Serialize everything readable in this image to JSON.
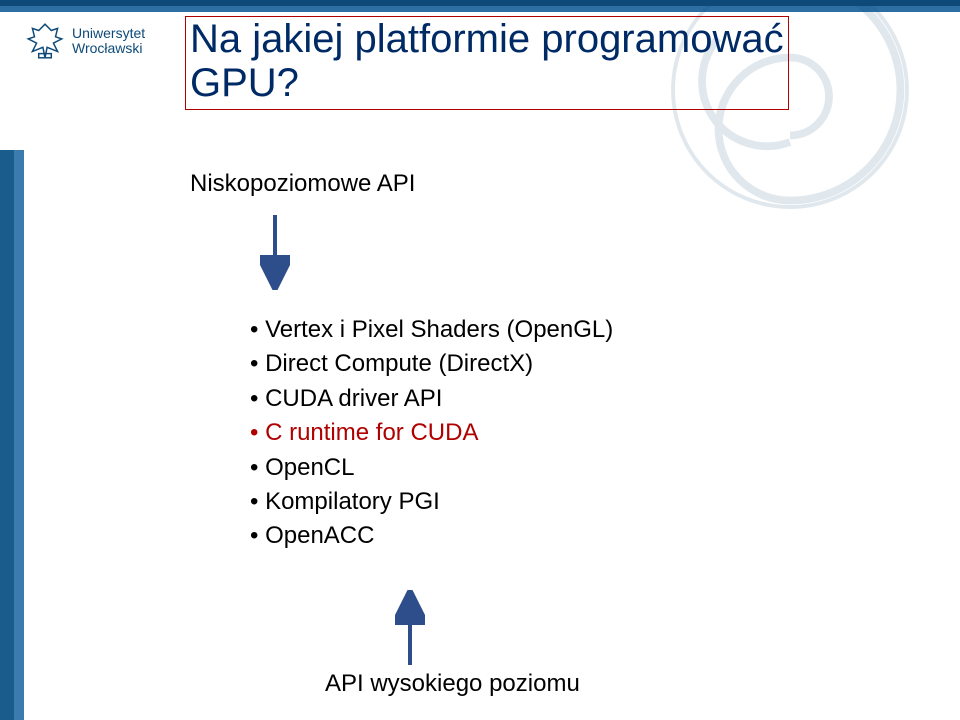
{
  "university": {
    "line1": "Uniwersytet",
    "line2": "Wrocławski"
  },
  "title": {
    "line1": "Na jakiej platformie programować",
    "line2": "GPU?"
  },
  "labels": {
    "top": "Niskopoziomowe API",
    "bottom": "API wysokiego poziomu"
  },
  "bullets": [
    {
      "text": "Vertex i Pixel Shaders (OpenGL)",
      "hl": false
    },
    {
      "text": "Direct Compute (DirectX)",
      "hl": false
    },
    {
      "text": "CUDA driver API",
      "hl": false
    },
    {
      "text": "C runtime for CUDA",
      "hl": true
    },
    {
      "text": "OpenCL",
      "hl": false
    },
    {
      "text": "Kompilatory PGI",
      "hl": false
    },
    {
      "text": "OpenACC",
      "hl": false
    }
  ],
  "colors": {
    "brand": "#0d4a79",
    "accent2": "#3b7bad",
    "highlight": "#b00000",
    "arrow": "#2e4e8b"
  }
}
